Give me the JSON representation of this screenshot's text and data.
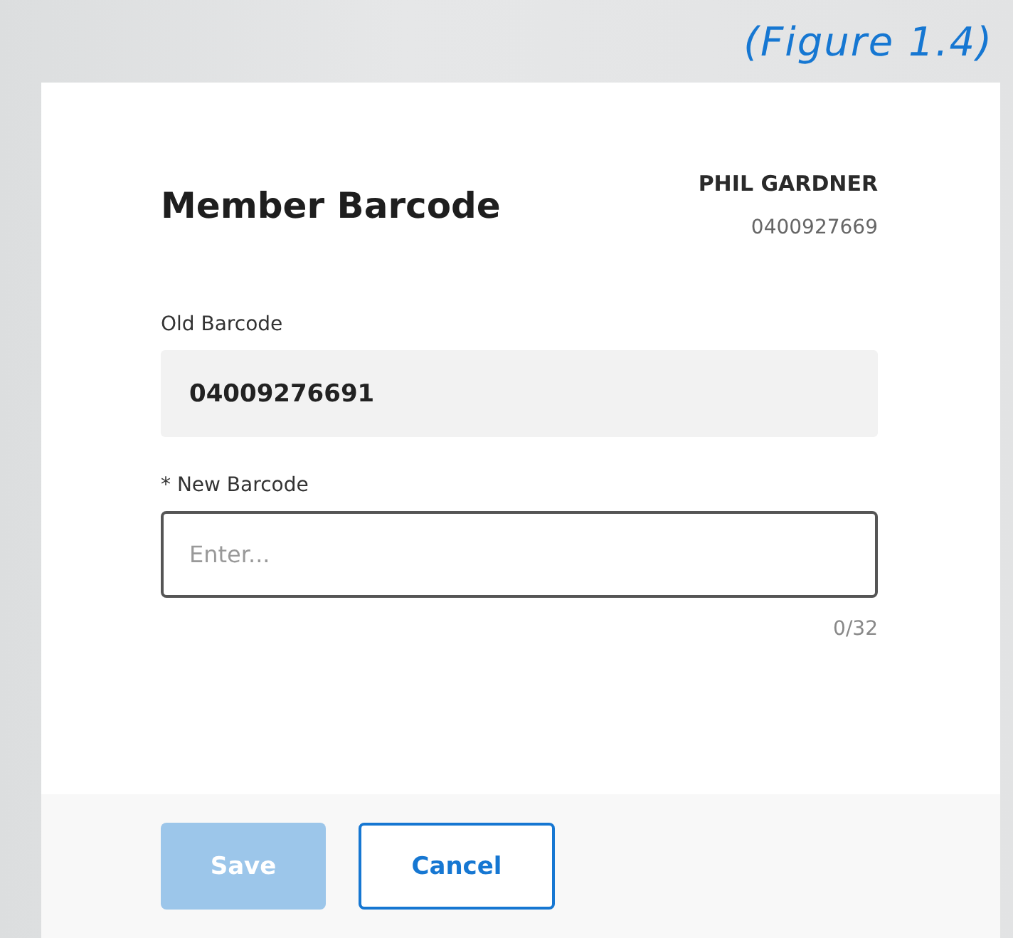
{
  "caption": "(Figure 1.4)",
  "dialog": {
    "title": "Member Barcode",
    "member_name": "PHIL GARDNER",
    "member_number": "0400927669",
    "fields": [
      {
        "kind": "readonly",
        "label": "Old Barcode",
        "value": "04009276691"
      },
      {
        "kind": "input",
        "label": "* New Barcode",
        "placeholder": "Enter...",
        "counter": "0/32"
      }
    ],
    "buttons": [
      {
        "kind": "primary",
        "label": "Save",
        "disabled": true
      },
      {
        "kind": "secondary",
        "label": "Cancel",
        "disabled": false
      }
    ]
  }
}
